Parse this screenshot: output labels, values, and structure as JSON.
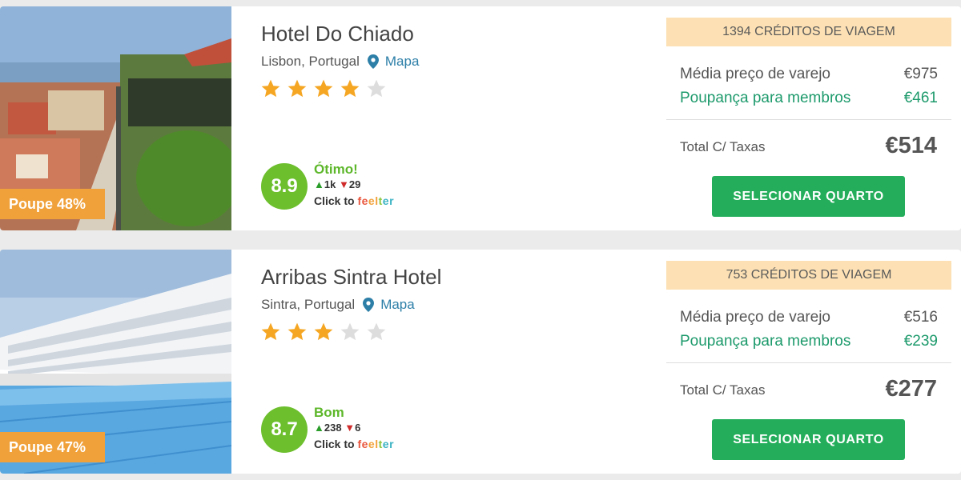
{
  "colors": {
    "accent_green": "#24ae5b",
    "savings_green": "#1d9a6c",
    "badge_orange": "#f0a13a",
    "credits_bg": "#fde1b4",
    "star_filled": "#f5a623",
    "star_empty": "#dddddd",
    "rating_green": "#6dbf2e"
  },
  "hotels": [
    {
      "name": "Hotel Do Chiado",
      "location": "Lisbon, Portugal",
      "map_label": "Mapa",
      "stars_filled": 4,
      "stars_total": 5,
      "save_badge": "Poupe 48%",
      "rating_score": "8.9",
      "rating_word": "Ótimo!",
      "votes_up": "1k",
      "votes_down": "29",
      "click_to": "Click to",
      "feelter": "feelter",
      "credits": "1394 CRÉDITOS DE VIAGEM",
      "retail_label": "Média preço de varejo",
      "retail_value": "€975",
      "savings_label": "Poupança para membros",
      "savings_value": "€461",
      "total_label": "Total C/ Taxas",
      "total_value": "€514",
      "button_label": "SELECIONAR QUARTO"
    },
    {
      "name": "Arribas Sintra Hotel",
      "location": "Sintra, Portugal",
      "map_label": "Mapa",
      "stars_filled": 3,
      "stars_total": 5,
      "save_badge": "Poupe 47%",
      "rating_score": "8.7",
      "rating_word": "Bom",
      "votes_up": "238",
      "votes_down": "6",
      "click_to": "Click to",
      "feelter": "feelter",
      "credits": "753 CRÉDITOS DE VIAGEM",
      "retail_label": "Média preço de varejo",
      "retail_value": "€516",
      "savings_label": "Poupança para membros",
      "savings_value": "€239",
      "total_label": "Total C/ Taxas",
      "total_value": "€277",
      "button_label": "SELECIONAR QUARTO"
    }
  ]
}
